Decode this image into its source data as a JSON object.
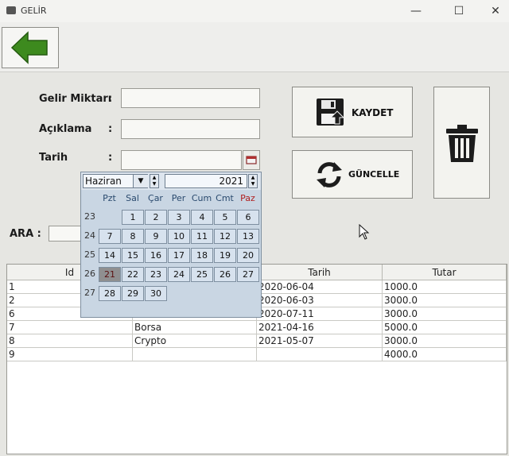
{
  "window": {
    "title": "GELİR",
    "minimize": "—",
    "maximize": "☐",
    "close": "✕"
  },
  "form": {
    "gelir_label": "Gelir Miktarı",
    "aciklama_label": "Açıklama",
    "tarih_label": "Tarih",
    "colon": ":",
    "gelir_value": "",
    "aciklama_value": "",
    "tarih_value": ""
  },
  "buttons": {
    "save": "KAYDET",
    "update": "GÜNCELLE"
  },
  "search": {
    "label": "ARA :",
    "value": ""
  },
  "calendar": {
    "month": "Haziran",
    "year": "2021",
    "days_of_week": [
      "Pzt",
      "Sal",
      "Çar",
      "Per",
      "Cum",
      "Cmt",
      "Paz"
    ],
    "weeks": [
      {
        "no": "23",
        "days": [
          "",
          "1",
          "2",
          "3",
          "4",
          "5",
          "6"
        ]
      },
      {
        "no": "24",
        "days": [
          "7",
          "8",
          "9",
          "10",
          "11",
          "12",
          "13"
        ]
      },
      {
        "no": "25",
        "days": [
          "14",
          "15",
          "16",
          "17",
          "18",
          "19",
          "20"
        ]
      },
      {
        "no": "26",
        "days": [
          "21",
          "22",
          "23",
          "24",
          "25",
          "26",
          "27"
        ]
      },
      {
        "no": "27",
        "days": [
          "28",
          "29",
          "30",
          "",
          "",
          "",
          ""
        ]
      }
    ],
    "today": "21",
    "colors": {
      "weekday": "#2a4a6e",
      "sunday": "#b02020"
    }
  },
  "table": {
    "columns": [
      "Id",
      "",
      "Tarih",
      "Tutar"
    ],
    "rows": [
      {
        "id": "1",
        "aciklama": "",
        "tarih": "2020-06-04",
        "tutar": "1000.0"
      },
      {
        "id": "2",
        "aciklama": "",
        "tarih": "2020-06-03",
        "tutar": "3000.0"
      },
      {
        "id": "6",
        "aciklama": "",
        "tarih": "2020-07-11",
        "tutar": "3000.0"
      },
      {
        "id": "7",
        "aciklama": "Borsa",
        "tarih": "2021-04-16",
        "tutar": "5000.0"
      },
      {
        "id": "8",
        "aciklama": "Crypto",
        "tarih": "2021-05-07",
        "tutar": "3000.0"
      },
      {
        "id": "9",
        "aciklama": "",
        "tarih": "",
        "tutar": "4000.0"
      }
    ]
  },
  "icons": {
    "back": "arrow-left-icon",
    "save": "floppy-icon",
    "update": "refresh-icon",
    "delete": "trash-icon",
    "date_picker": "calendar-icon"
  }
}
